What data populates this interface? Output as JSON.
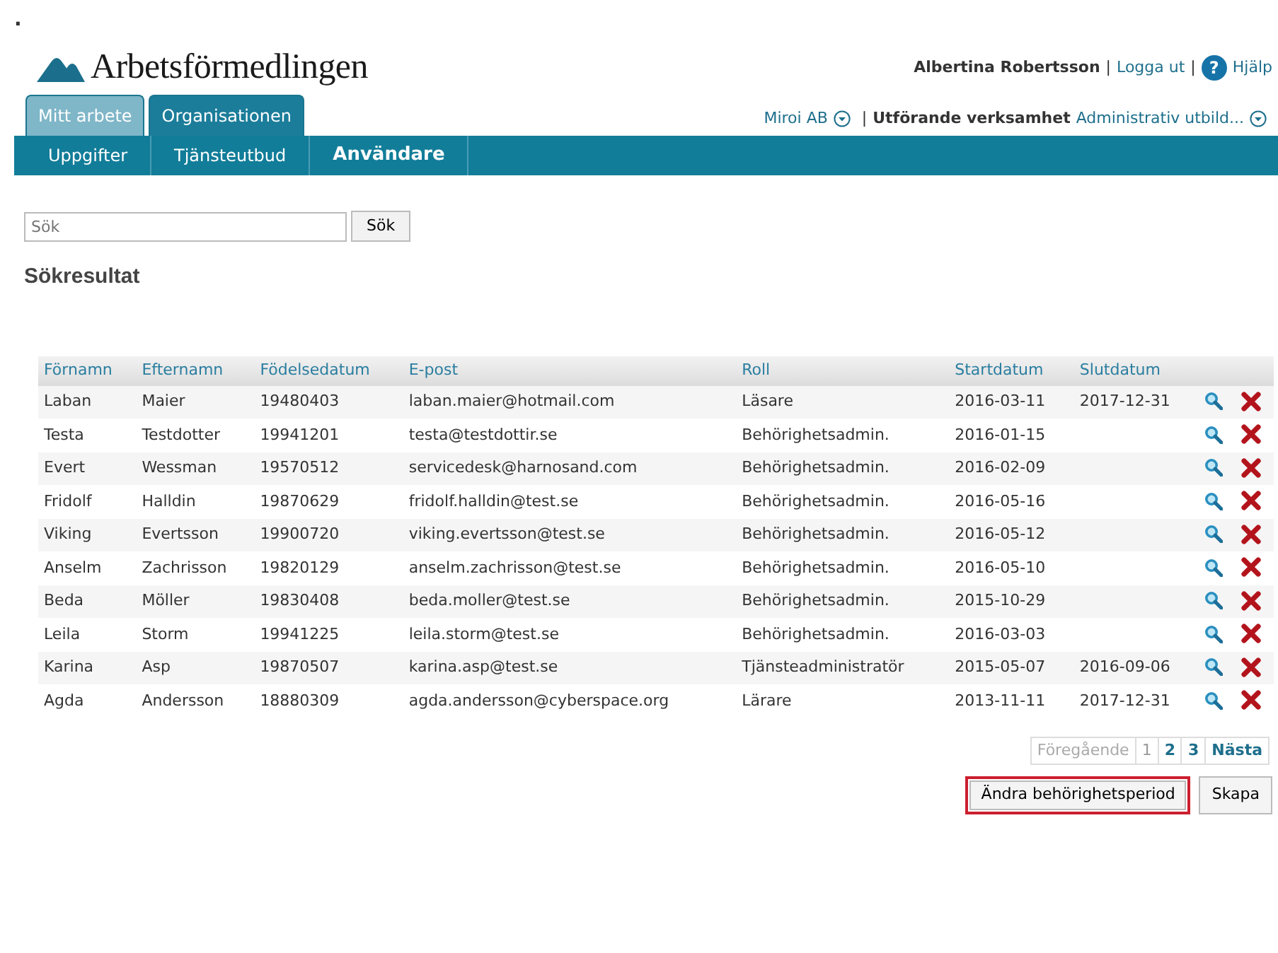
{
  "corner_mark": ".",
  "header": {
    "logo_text": "Arbetsförmedlingen",
    "user": "Albertina Robertsson",
    "separator_1": "|",
    "logout": "Logga ut",
    "separator_2": "|",
    "help_icon": "?",
    "help": "Hjälp"
  },
  "tabs": [
    {
      "label": "Mitt arbete",
      "selected": false
    },
    {
      "label": "Organisationen",
      "selected": true
    }
  ],
  "org_selector": {
    "organization": "Miroi AB",
    "separator": "|",
    "label": "Utförande verksamhet",
    "value": "Administrativ utbild..."
  },
  "subnav": [
    {
      "label": "Uppgifter",
      "selected": false
    },
    {
      "label": "Tjänsteutbud",
      "selected": false
    },
    {
      "label": "Användare",
      "selected": true
    }
  ],
  "search": {
    "placeholder": "Sök",
    "button": "Sök"
  },
  "results_title": "Sökresultat",
  "table": {
    "columns": [
      "Förnamn",
      "Efternamn",
      "Födelsedatum",
      "E-post",
      "Roll",
      "Startdatum",
      "Slutdatum"
    ],
    "rows": [
      {
        "cells": [
          "Laban",
          "Maier",
          "19480403",
          "laban.maier@hotmail.com",
          "Läsare",
          "2016-03-11",
          "2017-12-31"
        ]
      },
      {
        "cells": [
          "Testa",
          "Testdotter",
          "19941201",
          "testa@testdottir.se",
          "Behörighetsadmin.",
          "2016-01-15",
          null
        ]
      },
      {
        "cells": [
          "Evert",
          "Wessman",
          "19570512",
          "servicedesk@harnosand.com",
          "Behörighetsadmin.",
          "2016-02-09",
          null
        ]
      },
      {
        "cells": [
          "Fridolf",
          "Halldin",
          "19870629",
          "fridolf.halldin@test.se",
          "Behörighetsadmin.",
          "2016-05-16",
          null
        ]
      },
      {
        "cells": [
          "Viking",
          "Evertsson",
          "19900720",
          "viking.evertsson@test.se",
          "Behörighetsadmin.",
          "2016-05-12",
          null
        ]
      },
      {
        "cells": [
          "Anselm",
          "Zachrisson",
          "19820129",
          "anselm.zachrisson@test.se",
          "Behörighetsadmin.",
          "2016-05-10",
          null
        ]
      },
      {
        "cells": [
          "Beda",
          "Möller",
          "19830408",
          "beda.moller@test.se",
          "Behörighetsadmin.",
          "2015-10-29",
          null
        ]
      },
      {
        "cells": [
          "Leila",
          "Storm",
          "19941225",
          "leila.storm@test.se",
          "Behörighetsadmin.",
          "2016-03-03",
          null
        ]
      },
      {
        "cells": [
          "Karina",
          "Asp",
          "19870507",
          "karina.asp@test.se",
          "Tjänsteadministratör",
          "2015-05-07",
          "2016-09-06"
        ]
      },
      {
        "cells": [
          "Agda",
          "Andersson",
          "18880309",
          "agda.andersson@cyberspace.org",
          "Lärare",
          "2013-11-11",
          "2017-12-31"
        ]
      }
    ]
  },
  "pagination": [
    {
      "label": "Föregående",
      "selected": false,
      "disabled": true
    },
    {
      "label": "1",
      "selected": true,
      "disabled": false
    },
    {
      "label": "2",
      "selected": false,
      "disabled": false
    },
    {
      "label": "3",
      "selected": false,
      "disabled": false
    },
    {
      "label": "Nästa",
      "selected": false,
      "disabled": false
    }
  ],
  "buttons": [
    {
      "label": "Ändra behörighetsperiod",
      "highlighted": true
    },
    {
      "label": "Skapa",
      "highlighted": false
    }
  ]
}
